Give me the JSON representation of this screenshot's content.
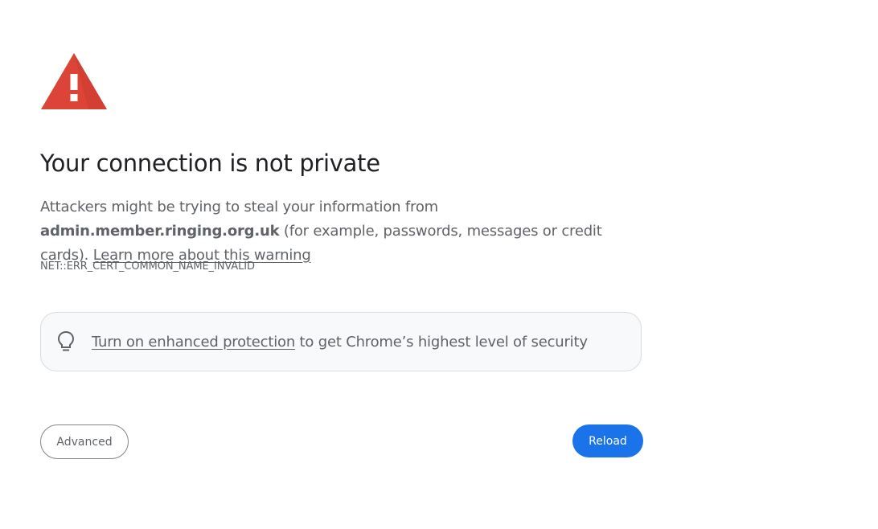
{
  "page": {
    "title": "Your connection is not private",
    "body": {
      "intro": "Attackers might be trying to steal your information from ",
      "host": "admin.member.ringing.org.uk",
      "detail": " (for example, passwords, messages or credit cards). ",
      "learn_more_link": "Learn more about this warning"
    },
    "error_code": "NET::ERR_CERT_COMMON_NAME_INVALID",
    "banner": {
      "link": "Turn on enhanced protection",
      "text": " to get Chrome’s highest level of security",
      "icon": "lightbulb-icon"
    },
    "warning_icon": "warning-triangle-icon",
    "buttons": {
      "advanced": "Advanced",
      "reload": "Reload"
    }
  },
  "colors": {
    "warning_red": "#db4437",
    "primary_blue": "#1a73e8",
    "text_secondary": "#5f6368",
    "banner_background": "#f8f9fa"
  }
}
